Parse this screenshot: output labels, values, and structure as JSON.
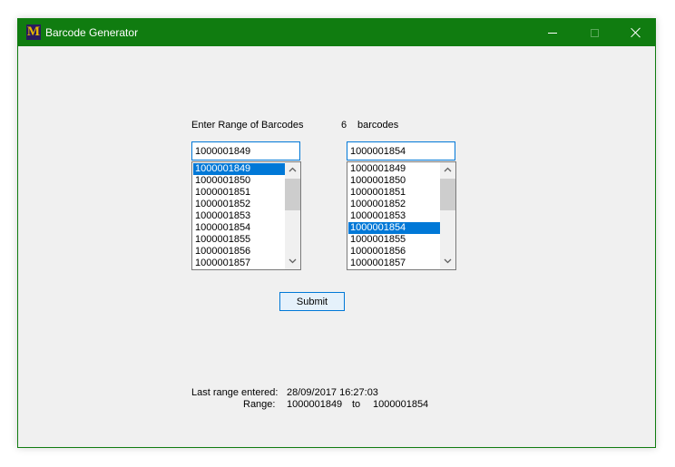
{
  "window": {
    "title": "Barcode Generator",
    "app_icon_letter": "M"
  },
  "form": {
    "range_label": "Enter Range of Barcodes",
    "count": "6",
    "count_suffix": "barcodes",
    "start_value": "1000001849",
    "end_value": "1000001854",
    "start_list": {
      "items": [
        "1000001849",
        "1000001850",
        "1000001851",
        "1000001852",
        "1000001853",
        "1000001854",
        "1000001855",
        "1000001856",
        "1000001857"
      ],
      "selected": "1000001849"
    },
    "end_list": {
      "items": [
        "1000001849",
        "1000001850",
        "1000001851",
        "1000001852",
        "1000001853",
        "1000001854",
        "1000001855",
        "1000001856",
        "1000001857"
      ],
      "selected": "1000001854"
    },
    "submit_label": "Submit"
  },
  "last": {
    "entered_label": "Last range entered:",
    "entered_value": "28/09/2017 16:27:03",
    "range_label": "Range:",
    "range_start": "1000001849",
    "range_to": "to",
    "range_end": "1000001854"
  },
  "colors": {
    "titlebar": "#107c10",
    "selection": "#0078d7",
    "focus_border": "#0078d7"
  },
  "icons": [
    "minimize-icon",
    "maximize-icon",
    "close-icon",
    "chevron-up-icon",
    "chevron-down-icon"
  ]
}
